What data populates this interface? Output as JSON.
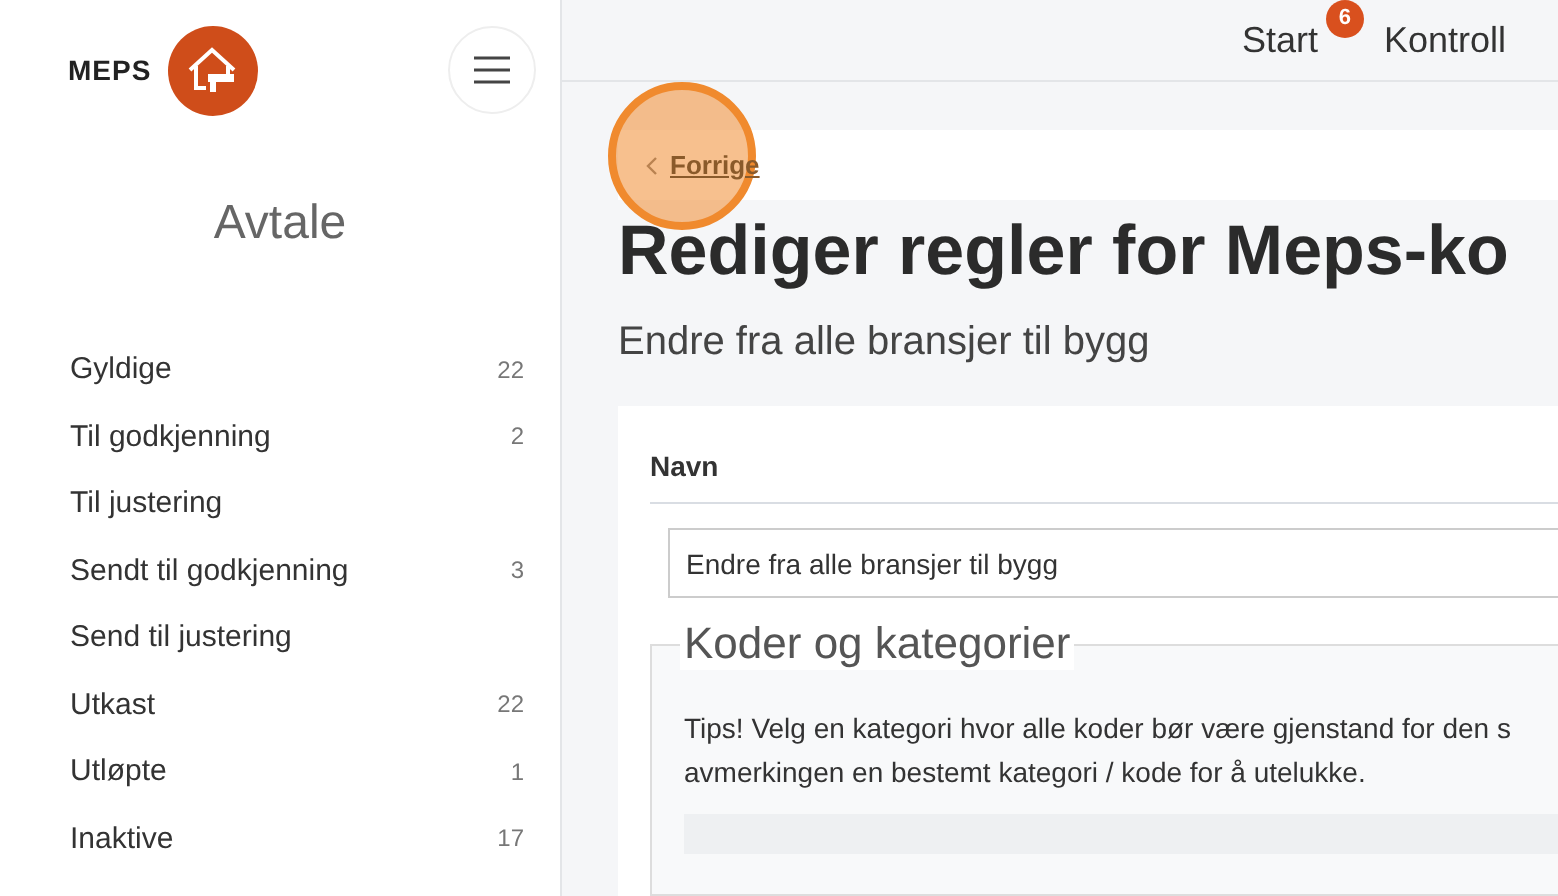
{
  "brand": {
    "name": "MEPS"
  },
  "sidebar": {
    "title": "Avtale",
    "items": [
      {
        "label": "Gyldige",
        "count": "22"
      },
      {
        "label": "Til godkjenning",
        "count": "2"
      },
      {
        "label": "Til justering"
      },
      {
        "label": "Sendt til godkjenning",
        "count": "3"
      },
      {
        "label": "Send til justering"
      },
      {
        "label": "Utkast",
        "count": "22"
      },
      {
        "label": "Utløpte",
        "count": "1"
      },
      {
        "label": "Inaktive",
        "count": "17"
      }
    ]
  },
  "header": {
    "nav": [
      {
        "label": "Start",
        "badge": "6"
      },
      {
        "label": "Kontroll"
      }
    ]
  },
  "breadcrumb": {
    "back": "Forrige"
  },
  "page": {
    "title": "Rediger regler for Meps-ko",
    "subtitle": "Endre fra alle bransjer til bygg"
  },
  "form": {
    "name_label": "Navn",
    "name_value": "Endre fra alle bransjer til bygg",
    "fieldset": "Koder og kategorier",
    "tip": "Tips! Velg en kategori hvor alle koder bør være gjenstand for den s",
    "tip_line2": "avmerkingen en bestemt kategori / kode for å utelukke."
  }
}
